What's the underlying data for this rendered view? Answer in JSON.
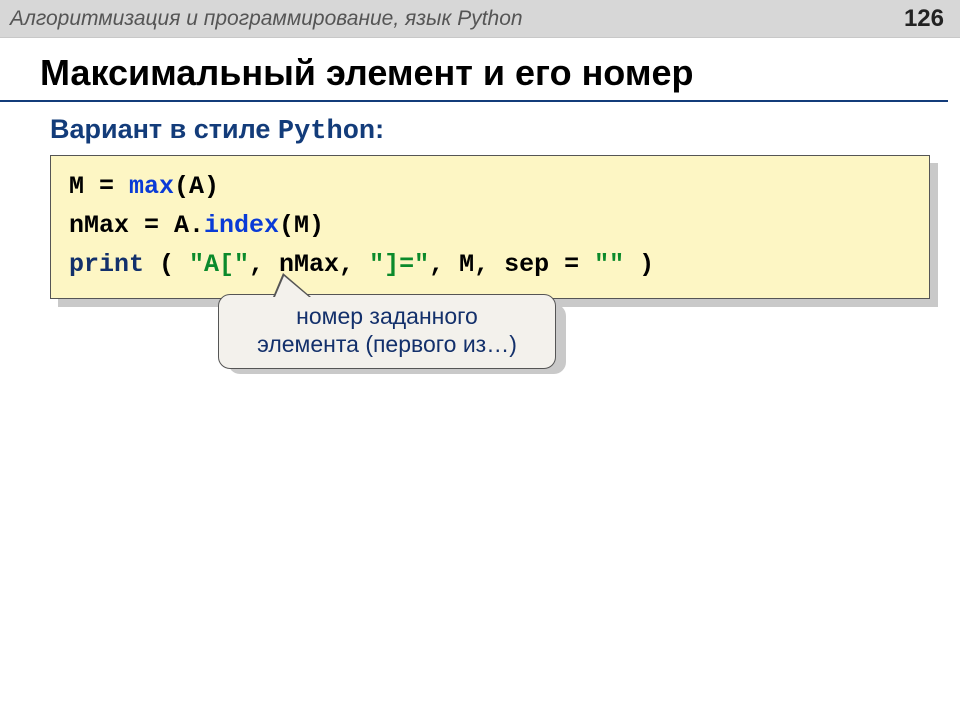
{
  "header": {
    "title": "Алгоритмизация и программирование, язык Python",
    "page": "126"
  },
  "slide_title": "Максимальный элемент и его номер",
  "subtitle": {
    "prefix": "Вариант в стиле ",
    "mono": "Python",
    "suffix": ":"
  },
  "code": {
    "l1": {
      "a": "M = ",
      "b": "max",
      "c": "(A)"
    },
    "l2": {
      "a": "nMax = A.",
      "b": "index",
      "c": "(M)"
    },
    "l3": {
      "a": "print",
      "b": " ( ",
      "c": "\"A[\"",
      "d": ", nMax, ",
      "e": "\"]=\"",
      "f": ", M, sep = ",
      "g": "\"\"",
      "h": " )"
    }
  },
  "callout": {
    "line1": "номер заданного",
    "line2": "элемента (первого из…)"
  }
}
